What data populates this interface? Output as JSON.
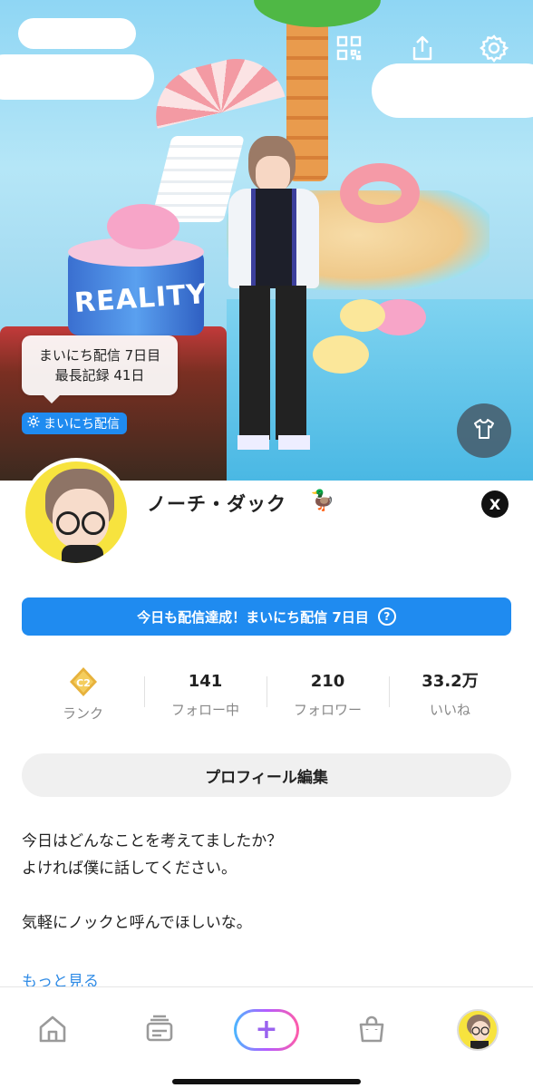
{
  "hero": {
    "scene_sign": "REALITY",
    "streak_tooltip": {
      "line1": "まいにち配信 7日目",
      "line2": "最長記録 41日"
    },
    "daily_chip": "まいにち配信"
  },
  "top_icons": [
    "qr-code-icon",
    "share-icon",
    "settings-icon"
  ],
  "profile": {
    "name": "ノーチ・ダック",
    "name_emoji": "🦆",
    "social_link": "X"
  },
  "streak_banner": {
    "text": "今日も配信達成！まいにち配信 7日目",
    "help": "?"
  },
  "stats": [
    {
      "value": "",
      "label": "ランク",
      "badge": "C2"
    },
    {
      "value": "141",
      "label": "フォロー中"
    },
    {
      "value": "210",
      "label": "フォロワー"
    },
    {
      "value": "33.2万",
      "label": "いいね"
    }
  ],
  "edit_profile_label": "プロフィール編集",
  "bio": {
    "line1": "今日はどんなことを考えてましたか？",
    "line2": "よければ僕に話してください。",
    "line3": "",
    "line4": "気軽にノックと呼んでほしいな。"
  },
  "more_label": "もっと見る",
  "bottom_nav": {
    "items": [
      "home-icon",
      "feed-icon",
      "create-button",
      "shop-icon",
      "my-avatar"
    ],
    "create_symbol": "+"
  },
  "colors": {
    "accent_blue": "#1f8bf0",
    "link_blue": "#2f8be6",
    "avatar_bg": "#f7e33e"
  }
}
